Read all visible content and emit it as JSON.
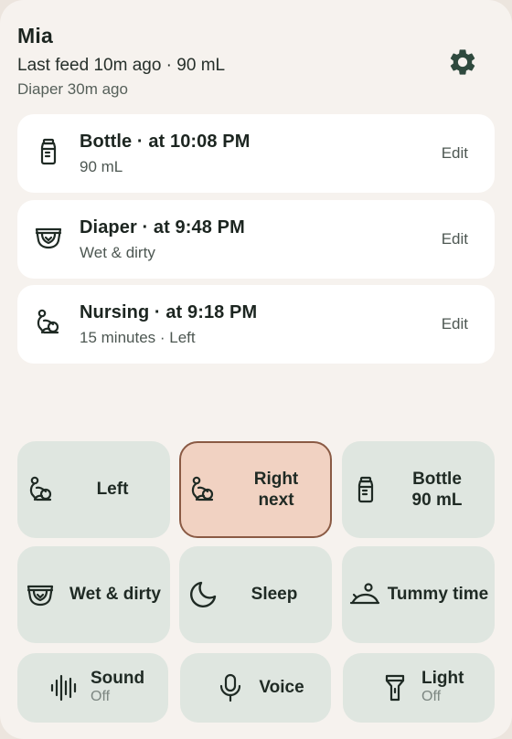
{
  "header": {
    "name": "Mia",
    "last_feed": "Last feed 10m ago · 90 mL",
    "diaper": "Diaper 30m ago",
    "settings_icon": "gear-icon"
  },
  "entries": [
    {
      "icon": "bottle-icon",
      "title": "Bottle · at 10:08 PM",
      "subtitle": "90 mL",
      "edit": "Edit"
    },
    {
      "icon": "diaper-icon",
      "title": "Diaper · at 9:48 PM",
      "subtitle": "Wet & dirty",
      "edit": "Edit"
    },
    {
      "icon": "nursing-icon",
      "title": "Nursing · at 9:18 PM",
      "subtitle": "15 minutes · Left",
      "edit": "Edit"
    }
  ],
  "actions": {
    "left": {
      "icon": "nursing-icon",
      "label": "Left"
    },
    "right": {
      "icon": "nursing-icon",
      "line1": "Right",
      "line2": "next"
    },
    "bottle": {
      "icon": "bottle-icon",
      "line1": "Bottle",
      "line2": "90 mL"
    },
    "diaper": {
      "icon": "diaper-icon",
      "label": "Wet & dirty"
    },
    "sleep": {
      "icon": "moon-icon",
      "label": "Sleep"
    },
    "tummy": {
      "icon": "tummy-time-icon",
      "label": "Tummy time"
    },
    "sound": {
      "icon": "sound-wave-icon",
      "label": "Sound",
      "state": "Off"
    },
    "voice": {
      "icon": "microphone-icon",
      "label": "Voice"
    },
    "light": {
      "icon": "flashlight-icon",
      "label": "Light",
      "state": "Off"
    }
  },
  "colors": {
    "background": "#f6f2ee",
    "card": "#ffffff",
    "button": "#dfe6e0",
    "active_button": "#f1d2c2",
    "active_border": "#8a5a44",
    "accent_icon": "#2f4a3e"
  }
}
